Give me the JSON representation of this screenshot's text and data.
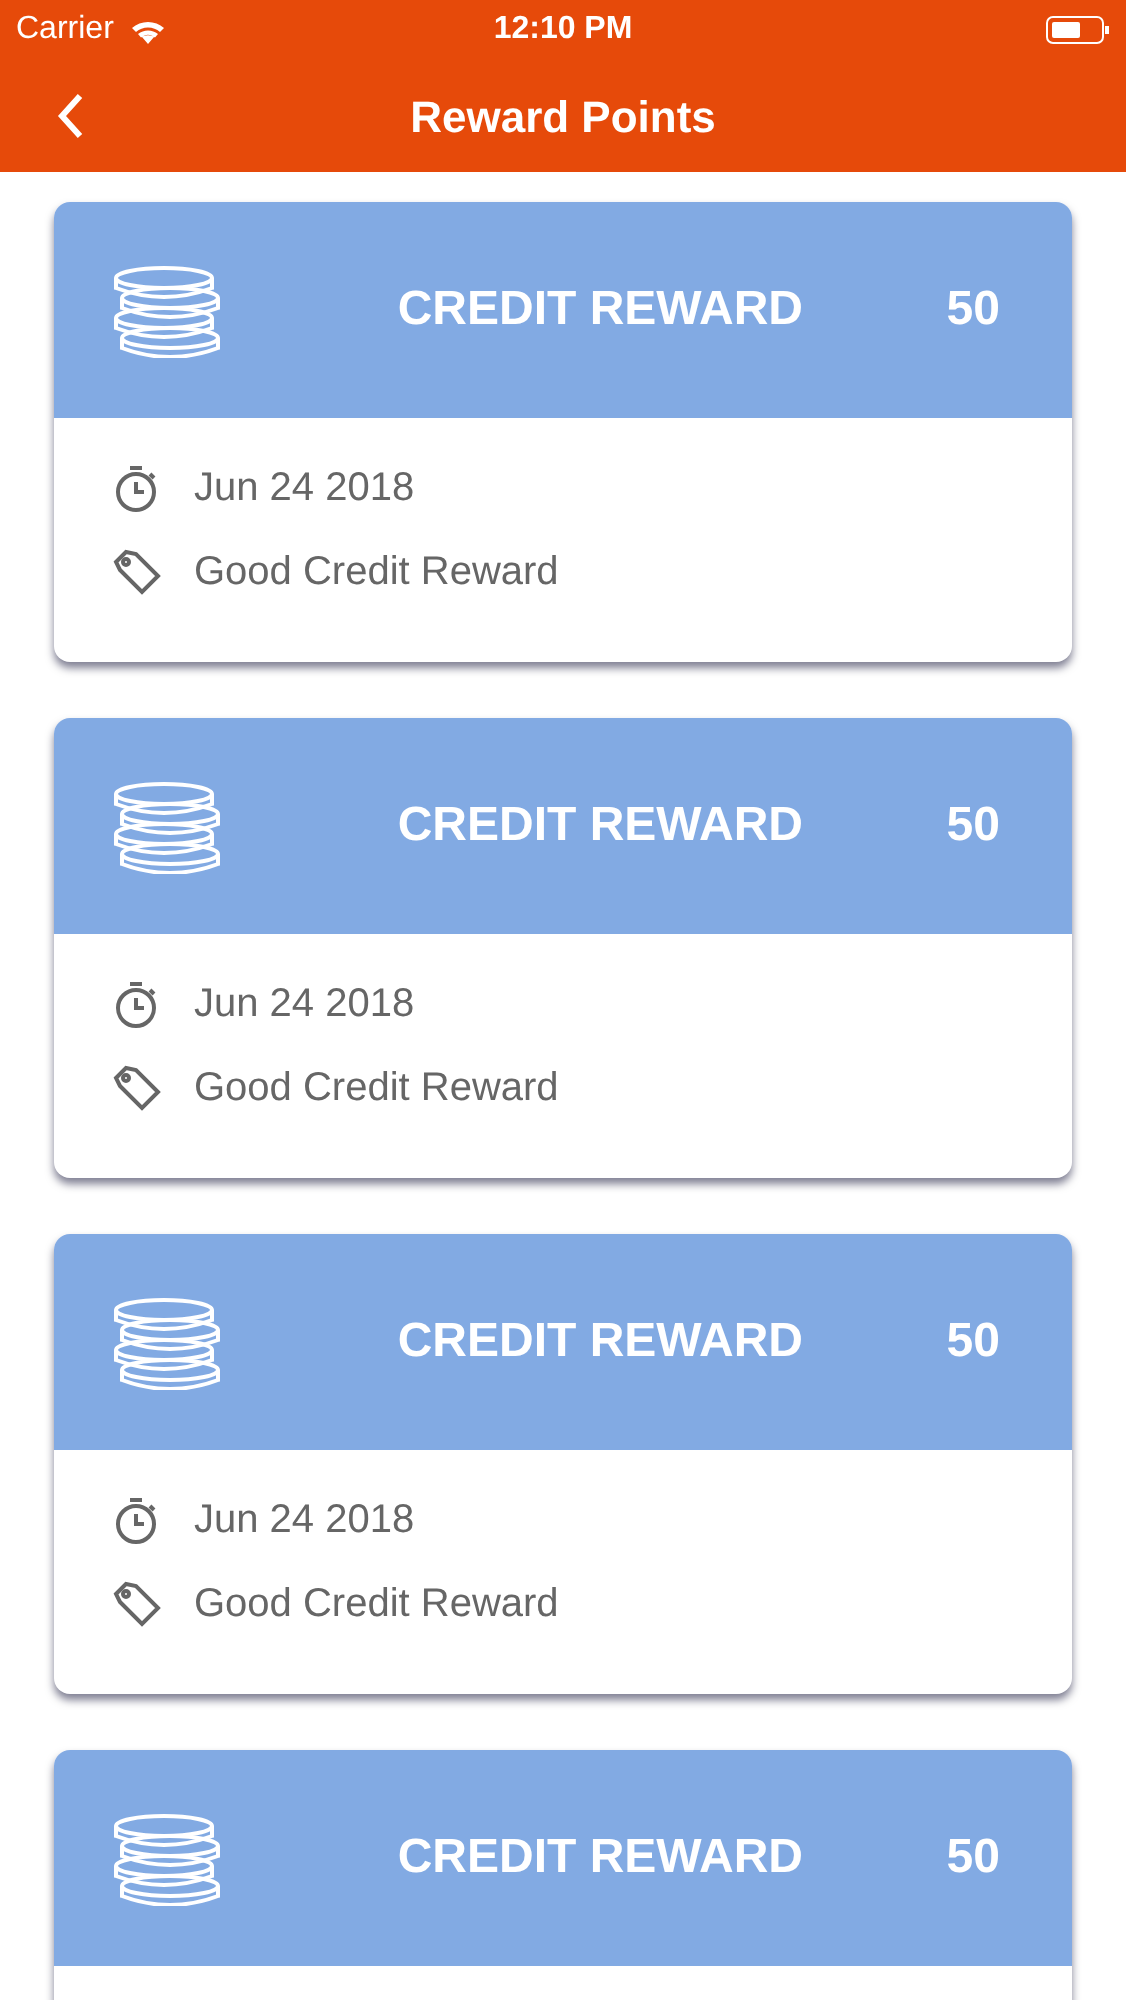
{
  "status_bar": {
    "carrier": "Carrier",
    "time": "12:10 PM"
  },
  "nav": {
    "title": "Reward Points"
  },
  "rewards": [
    {
      "title": "CREDIT REWARD",
      "points": "50",
      "date": "Jun 24 2018",
      "description": "Good Credit Reward"
    },
    {
      "title": "CREDIT REWARD",
      "points": "50",
      "date": "Jun 24 2018",
      "description": "Good Credit Reward"
    },
    {
      "title": "CREDIT REWARD",
      "points": "50",
      "date": "Jun 24 2018",
      "description": "Good Credit Reward"
    },
    {
      "title": "CREDIT REWARD",
      "points": "50"
    }
  ]
}
